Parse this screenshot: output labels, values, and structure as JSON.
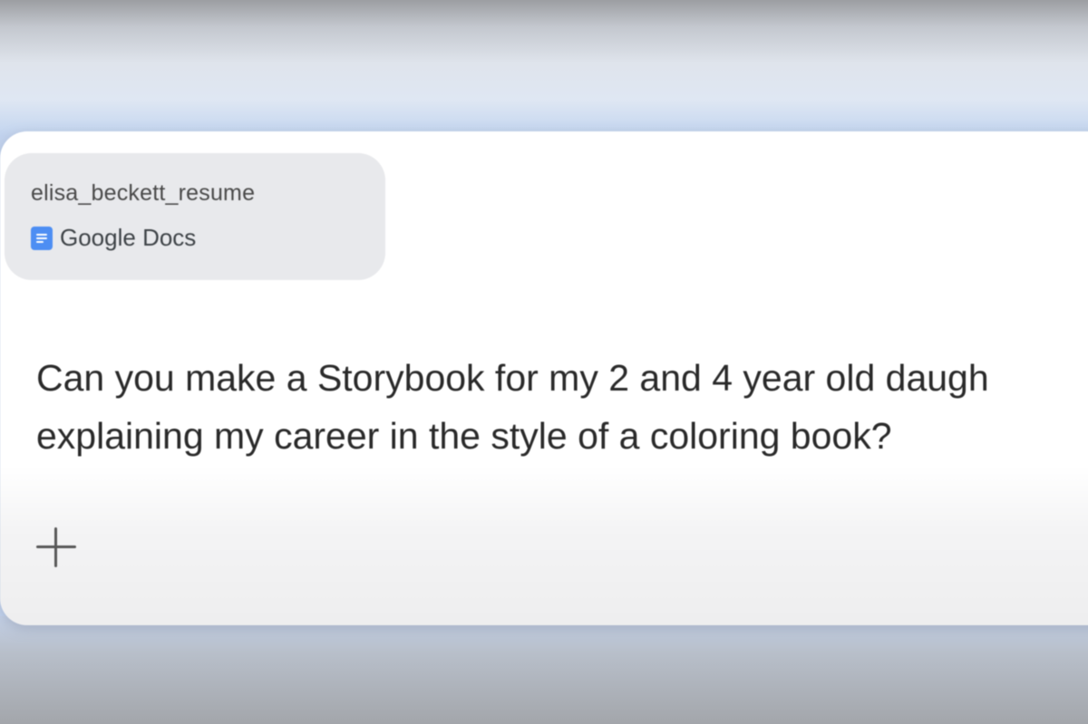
{
  "attachment": {
    "title": "elisa_beckett_resume",
    "source": "Google Docs",
    "icon": "google-docs-icon"
  },
  "prompt": {
    "line1": "Can you make a Storybook for my 2 and 4 year old daugh",
    "line2": "explaining my career in the style of a coloring book?"
  },
  "toolbar": {
    "add_icon": "plus-icon"
  },
  "colors": {
    "docs_blue": "#4d8ef3",
    "chip_background": "#e8e9ec",
    "card_background": "#ffffff",
    "text": "#2a2a2a"
  }
}
